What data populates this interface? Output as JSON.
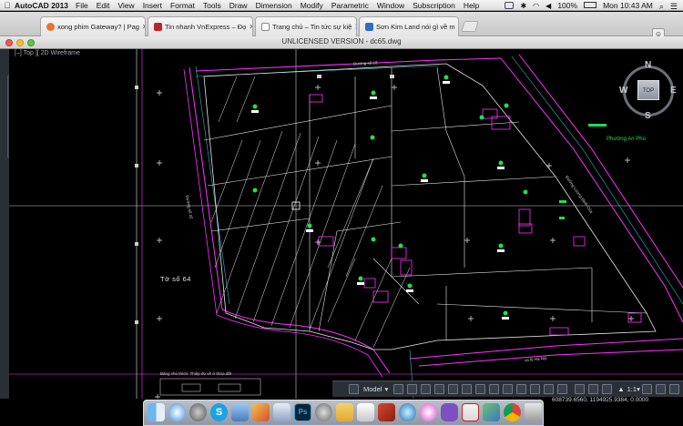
{
  "menubar": {
    "app_name": "AutoCAD 2013",
    "items": [
      "File",
      "Edit",
      "View",
      "Insert",
      "Format",
      "Tools",
      "Draw",
      "Dimension",
      "Modify",
      "Parametric",
      "Window",
      "Subscription",
      "Help"
    ],
    "battery": "100%",
    "clock": "Mon 10:43 AM"
  },
  "browser": {
    "tabs": [
      {
        "label": "xong phim Gateway? | Pag",
        "color": "#e8752a"
      },
      {
        "label": "Tin nhanh VnExpress – Đọ",
        "color": "#b8252a"
      },
      {
        "label": "Trang chủ – Tin tức sự kiệ",
        "color": "#555555"
      },
      {
        "label": "Sơn Kim Land nói gì về m",
        "color": "#2f6fc4"
      }
    ]
  },
  "window": {
    "title": "UNLICENSED VERSION  -  dc65.dwg",
    "view_label": "[–] Top ][ 2D Wireframe"
  },
  "drawing": {
    "labels": {
      "to_so": "Tờ   số   64",
      "phuong": "Phường An Phú",
      "road_top": "Đường số 18",
      "road_left": "Đường số 22",
      "road_right": "Đường Lương Định Của",
      "road_bottom": "xa lộ Hà Nội",
      "bottom_note": "Bảng chú thích: Thiệp đo vẽ ở thửa đất"
    }
  },
  "viewcube": {
    "n": "N",
    "s": "S",
    "e": "E",
    "w": "W",
    "face": "TOP"
  },
  "status": {
    "model_label": "Model",
    "scale": "1:1",
    "coords": "608739.6560, 1194925.9384, 0.0000"
  },
  "colors": {
    "magenta": "#ff33ff",
    "white": "#e8e8e8",
    "green": "#22dd55",
    "cyan": "#33bbcc",
    "boundary": "#ff4d4d"
  }
}
